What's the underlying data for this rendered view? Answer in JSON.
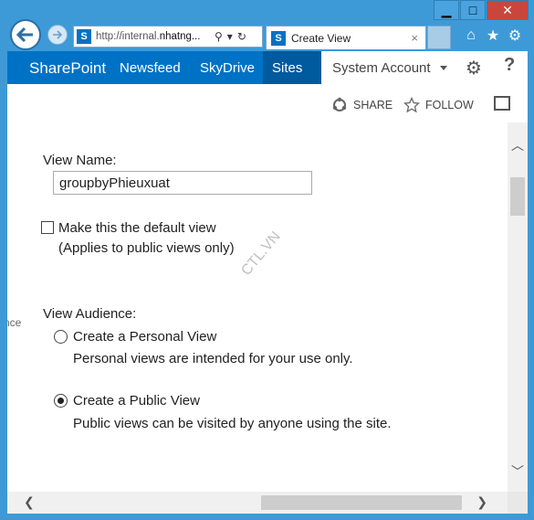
{
  "browser": {
    "address": "http://internal.",
    "address_host": "nhatng...",
    "tab_title": "Create View",
    "tab_close": "×",
    "search_glyph": "⚲",
    "refresh_glyph": "↻",
    "dropdown_glyph": "▾",
    "window_buttons": [
      "▁",
      "□",
      "✕"
    ]
  },
  "suite": {
    "brand": "SharePoint",
    "links": [
      "Newsfeed",
      "SkyDrive",
      "Sites"
    ],
    "account": "System Account",
    "help": "?"
  },
  "ribbon": {
    "share": "SHARE",
    "follow": "FOLLOW"
  },
  "form": {
    "view_name_label": "View Name:",
    "view_name_value": "groupbyPhieuxuat",
    "default_view_label": "Make this the default view",
    "default_view_note": "(Applies to public views only)",
    "default_view_checked": false,
    "audience_label": "View Audience:",
    "personal_label": "Create a Personal View",
    "personal_note": "Personal views are intended for your use only.",
    "personal_selected": false,
    "public_label": "Create a Public View",
    "public_note": "Public views can be visited by anyone using the site.",
    "public_selected": true,
    "left_cut_text": "nce"
  },
  "watermark": "CTL.VN",
  "colors": {
    "suite_blue": "#0072c6",
    "selected_tab": "#005a9e",
    "frame_blue": "#3d9ad7"
  }
}
